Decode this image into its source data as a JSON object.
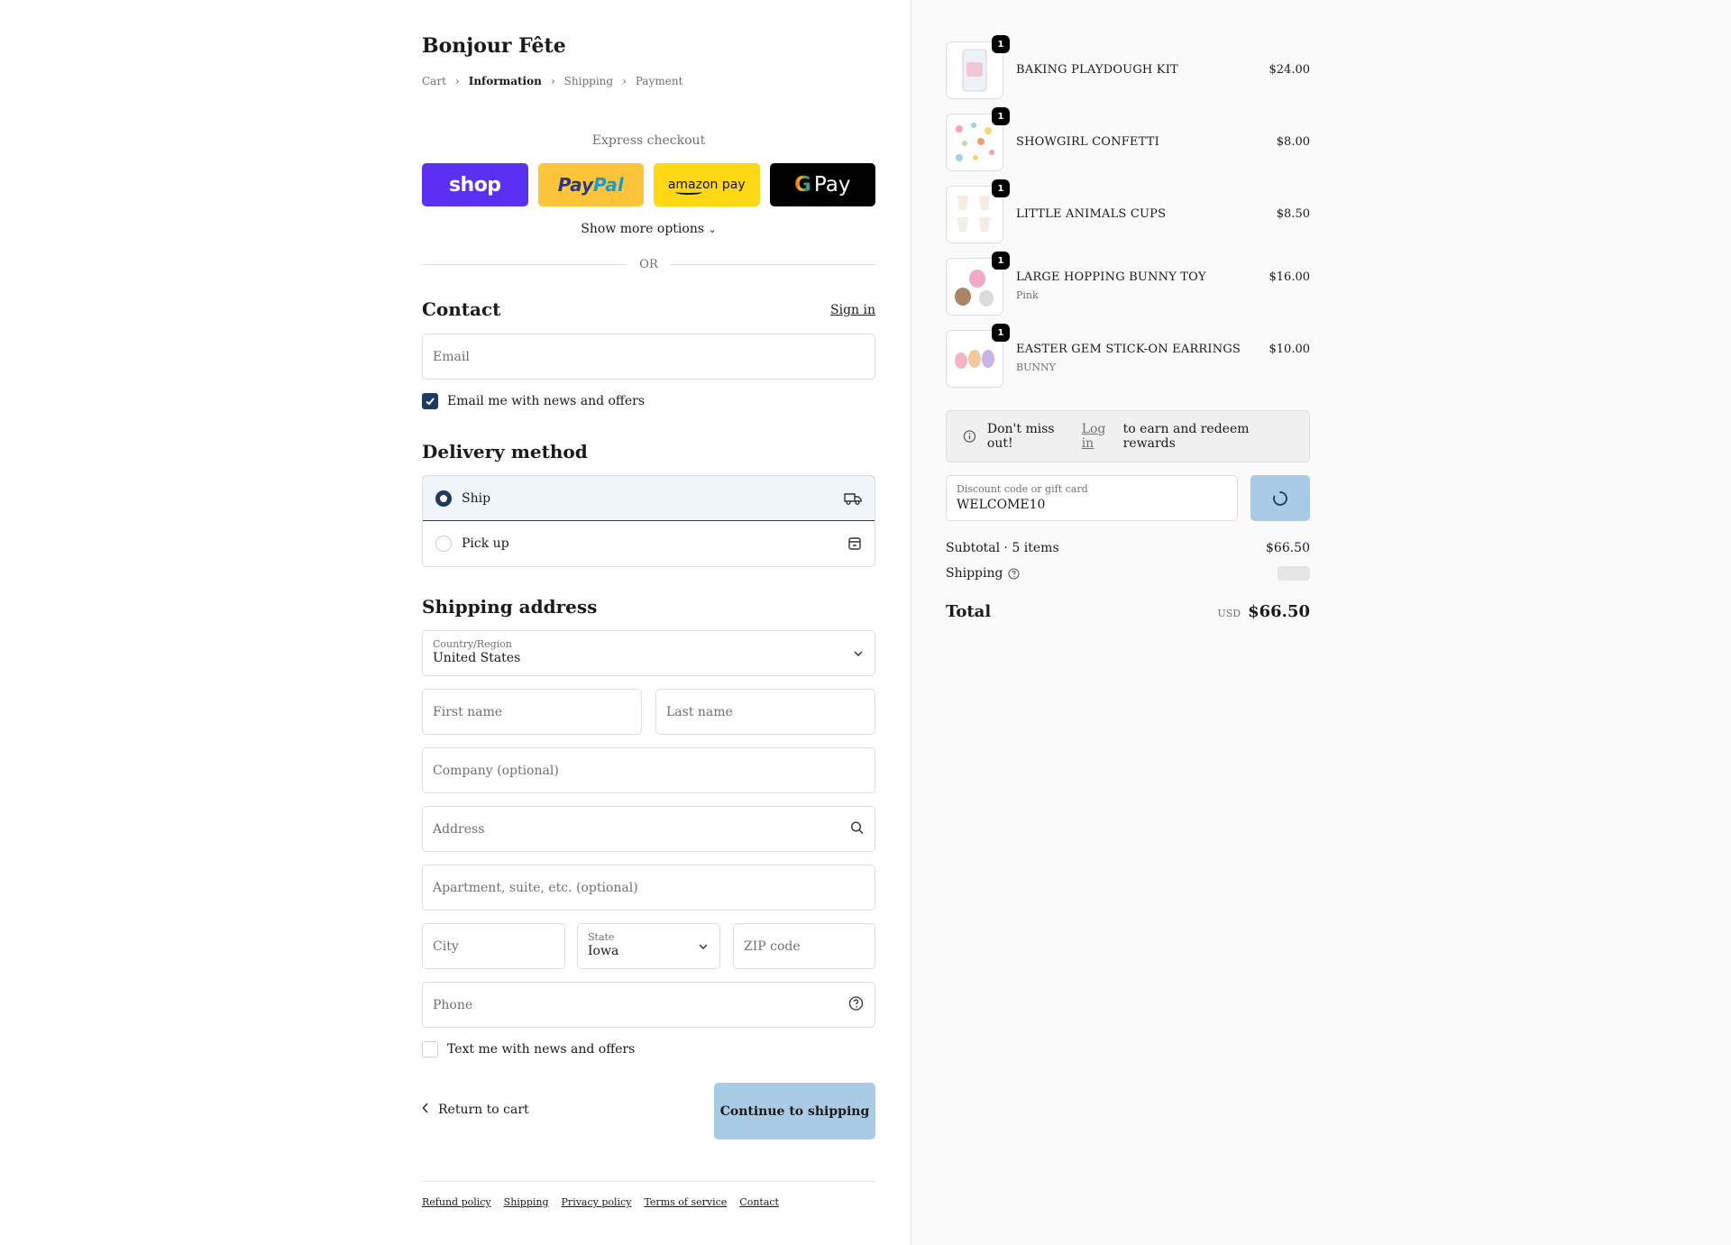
{
  "brand": "Bonjour Fête",
  "breadcrumbs": [
    "Cart",
    "Information",
    "Shipping",
    "Payment"
  ],
  "express": {
    "label": "Express checkout",
    "shop": "shop",
    "paypal_a": "Pay",
    "paypal_b": "Pal",
    "amazon": "amazon pay",
    "gpay_g": "G",
    "gpay": "Pay",
    "more": "Show more options",
    "or": "OR"
  },
  "contact": {
    "heading": "Contact",
    "signin": "Sign in",
    "email_placeholder": "Email",
    "news_checkbox": "Email me with news and offers",
    "news_checked": true
  },
  "delivery": {
    "heading": "Delivery method",
    "options": [
      {
        "label": "Ship",
        "selected": true,
        "icon": "truck-icon"
      },
      {
        "label": "Pick up",
        "selected": false,
        "icon": "store-icon"
      }
    ]
  },
  "shipping": {
    "heading": "Shipping address",
    "country_label": "Country/Region",
    "country": "United States",
    "first_name": "First name",
    "last_name": "Last name",
    "company": "Company (optional)",
    "address": "Address",
    "apartment": "Apartment, suite, etc. (optional)",
    "city": "City",
    "state_label": "State",
    "state": "Iowa",
    "zip": "ZIP code",
    "phone": "Phone",
    "text_checkbox": "Text me with news and offers"
  },
  "actions": {
    "return": "Return to cart",
    "continue": "Continue to shipping"
  },
  "footer": [
    "Refund policy",
    "Shipping",
    "Privacy policy",
    "Terms of service",
    "Contact"
  ],
  "cart": {
    "items": [
      {
        "name": "BAKING PLAYDOUGH KIT",
        "variant": "",
        "price": "$24.00",
        "qty": "1"
      },
      {
        "name": "SHOWGIRL CONFETTI",
        "variant": "",
        "price": "$8.00",
        "qty": "1"
      },
      {
        "name": "LITTLE ANIMALS CUPS",
        "variant": "",
        "price": "$8.50",
        "qty": "1"
      },
      {
        "name": "LARGE HOPPING BUNNY TOY",
        "variant": "Pink",
        "price": "$16.00",
        "qty": "1"
      },
      {
        "name": "EASTER GEM STICK-ON EARRINGS",
        "variant": "BUNNY",
        "price": "$10.00",
        "qty": "1"
      }
    ],
    "rewards_a": "Don't miss out!",
    "rewards_link": "Log in",
    "rewards_b": "to earn and redeem rewards",
    "discount_label": "Discount code or gift card",
    "discount_value": "WELCOME10",
    "subtotal_label": "Subtotal · 5 items",
    "subtotal": "$66.50",
    "shipping_label": "Shipping",
    "total_label": "Total",
    "currency": "USD",
    "total": "$66.50"
  },
  "colors": {
    "accent": "#1e3a5f",
    "button": "#a9cbe6",
    "shop": "#5a31f4",
    "paypal": "#ffc439",
    "amazon": "#ffd814"
  }
}
